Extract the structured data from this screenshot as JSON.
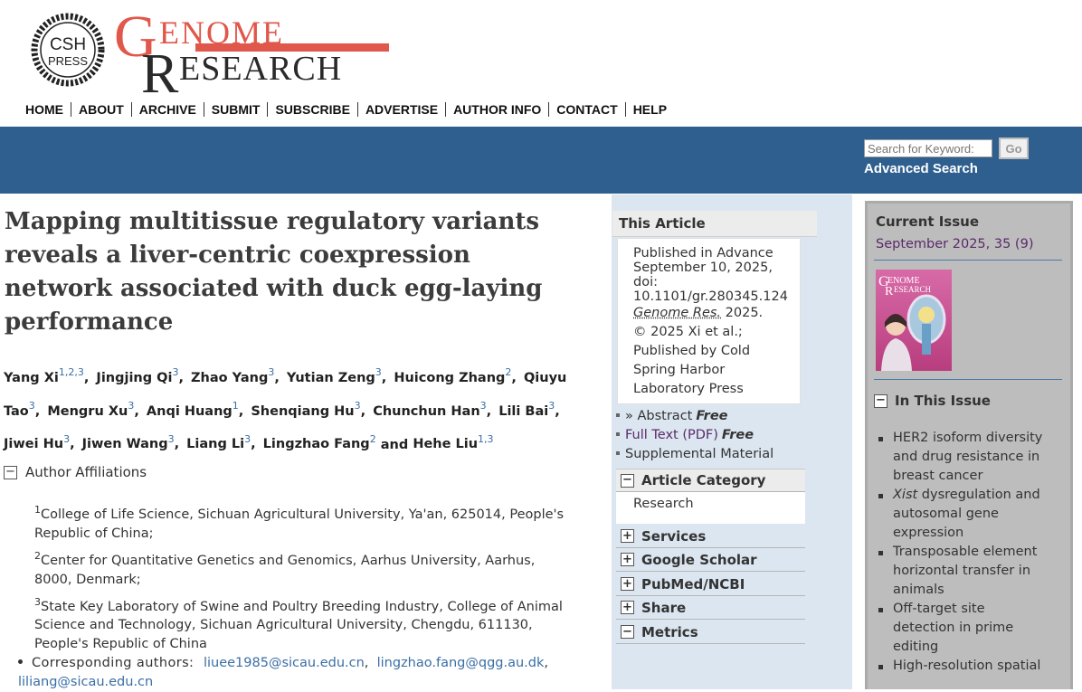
{
  "brand": {
    "csh_text_1": "CSH",
    "csh_text_2": "PRESS",
    "genome_big": "G",
    "genome_rest": "ENOME",
    "research_big": "R",
    "research_rest": "ESEARCH",
    "accent_color": "#e0574b"
  },
  "nav": [
    "HOME",
    "ABOUT",
    "ARCHIVE",
    "SUBMIT",
    "SUBSCRIBE",
    "ADVERTISE",
    "AUTHOR INFO",
    "CONTACT",
    "HELP"
  ],
  "search": {
    "placeholder": "Search for Keyword:",
    "go_label": "Go",
    "advanced_label": "Advanced Search"
  },
  "article": {
    "title": "Mapping multitissue regulatory variants reveals a liver-centric coexpression network associated with duck egg-laying performance",
    "authors": [
      {
        "name": "Yang Xi",
        "sup": "1,2,3"
      },
      {
        "name": "Jingjing Qi",
        "sup": "3"
      },
      {
        "name": "Zhao Yang",
        "sup": "3"
      },
      {
        "name": "Yutian Zeng",
        "sup": "3"
      },
      {
        "name": "Huicong Zhang",
        "sup": "2"
      },
      {
        "name": "Qiuyu Tao",
        "sup": "3"
      },
      {
        "name": "Mengru Xu",
        "sup": "3"
      },
      {
        "name": "Anqi Huang",
        "sup": "1"
      },
      {
        "name": "Shenqiang Hu",
        "sup": "3"
      },
      {
        "name": "Chunchun Han",
        "sup": "3"
      },
      {
        "name": "Lili Bai",
        "sup": "3"
      },
      {
        "name": "Jiwei Hu",
        "sup": "3"
      },
      {
        "name": "Jiwen Wang",
        "sup": "3"
      },
      {
        "name": "Liang Li",
        "sup": "3"
      },
      {
        "name": "Lingzhao Fang",
        "sup": "2"
      },
      {
        "name": "Hehe Liu",
        "sup": "1,3"
      }
    ],
    "author_connector": "and",
    "affiliations_label": "Author Affiliations",
    "affiliations": [
      {
        "num": "1",
        "text": "College of Life Science, Sichuan Agricultural University, Ya'an, 625014, People's Republic of China;"
      },
      {
        "num": "2",
        "text": "Center for Quantitative Genetics and Genomics, Aarhus University, Aarhus, 8000, Denmark;"
      },
      {
        "num": "3",
        "text": "State Key Laboratory of Swine and Poultry Breeding Industry, College of Animal Science and Technology, Sichuan Agricultural University, Chengdu, 611130, People's Republic of China"
      }
    ],
    "corresponding_label": "Corresponding authors:",
    "emails": [
      "liuee1985@sicau.edu.cn",
      "lingzhao.fang@qgg.au.dk",
      "liliang@sicau.edu.cn"
    ]
  },
  "this_article": {
    "heading": "This Article",
    "published_line1": "Published in Advance",
    "published_line2": "September 10, 2025,",
    "doi_label": "doi:",
    "doi_value": "10.1101/gr.280345.124",
    "journal": "Genome Res.",
    "year": "2025.",
    "copyright_1": "© 2025 Xi et al.;",
    "copyright_2": "Published by Cold",
    "copyright_3": "Spring Harbor",
    "copyright_4": "Laboratory Press",
    "abstract_label": "» Abstract",
    "abstract_free": "Free",
    "fulltext_label": "Full Text (PDF)",
    "fulltext_free": "Free",
    "supplemental_label": "Supplemental Material",
    "category_heading": "Article Category",
    "category_value": "Research",
    "services_heading": "Services",
    "scholar_heading": "Google Scholar",
    "pubmed_heading": "PubMed/NCBI",
    "share_heading": "Share",
    "metrics_heading": "Metrics"
  },
  "current_issue": {
    "heading": "Current Issue",
    "date": "September 2025, 35 (9)",
    "cover_title_big": "G",
    "cover_title_rest": "ENOME",
    "cover_title2_big": "R",
    "cover_title2_rest": "ESEARCH",
    "in_issue_heading": "In This Issue",
    "items": [
      {
        "pre": "",
        "ital": "",
        "text": "HER2 isoform diversity and drug resistance in breast cancer"
      },
      {
        "pre": "",
        "ital": "Xist",
        "text": " dysregulation and autosomal gene expression"
      },
      {
        "pre": "",
        "ital": "",
        "text": "Transposable element horizontal transfer in animals"
      },
      {
        "pre": "",
        "ital": "",
        "text": "Off-target site detection in prime editing"
      },
      {
        "pre": "",
        "ital": "",
        "text": "High-resolution spatial"
      }
    ]
  }
}
